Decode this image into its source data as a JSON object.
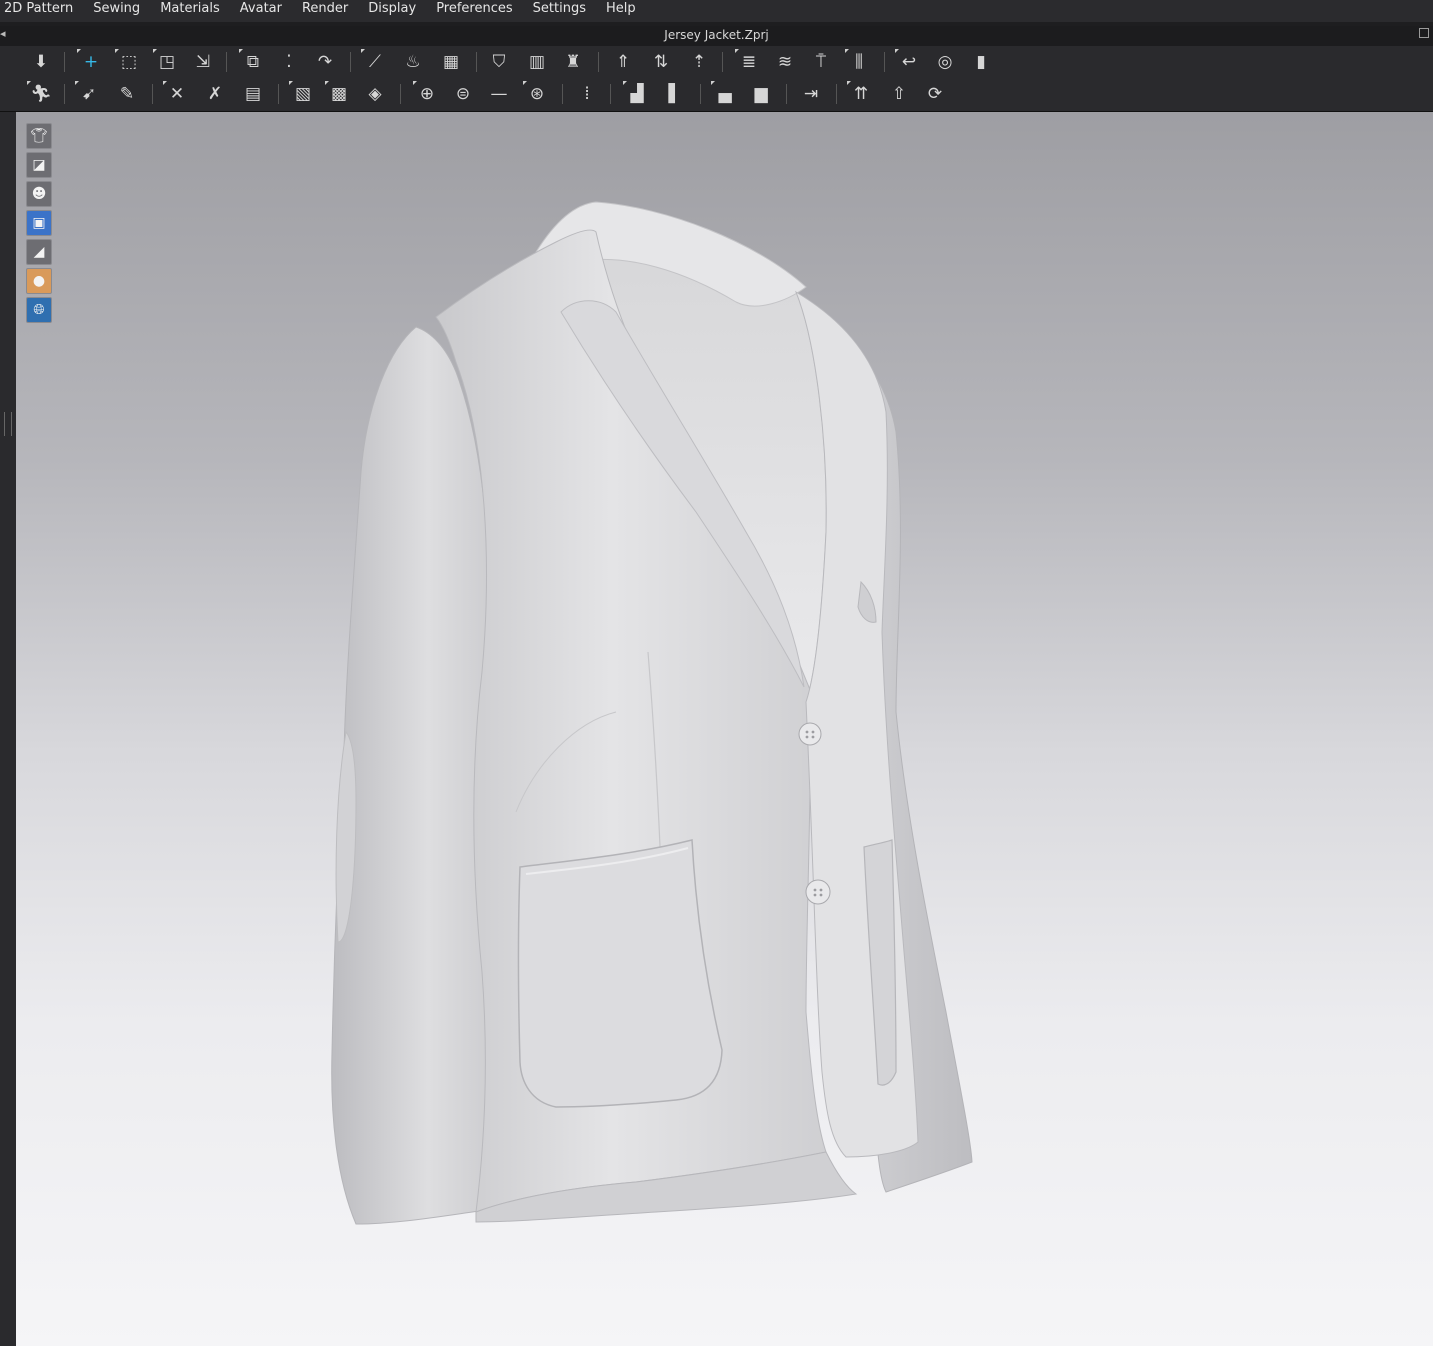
{
  "menubar": {
    "items": [
      "2D Pattern",
      "Sewing",
      "Materials",
      "Avatar",
      "Render",
      "Display",
      "Preferences",
      "Settings",
      "Help"
    ]
  },
  "window": {
    "title": "Jersey Jacket.Zprj"
  },
  "toolbar_row1": {
    "icons": [
      "simulation-icon",
      "select-move-icon",
      "select-mesh-box-icon",
      "select-mesh-brush-icon",
      "fold-arrangement-icon",
      "tack-icon",
      "tack-on-avatar-icon",
      "tack-between-icon",
      "edit-sewing-icon",
      "steam-icon",
      "shrinkage-brush-icon",
      "avatar-arrange-icon",
      "arrangement-point-icon",
      "dressing-icon",
      "fold-icon",
      "fold-down-icon",
      "fold-up-icon",
      "layer-up-icon",
      "layer-down-icon",
      "pin-icon",
      "pin-box-icon",
      "measure-circumference-icon",
      "measure-tape-icon",
      "ruler-icon"
    ]
  },
  "toolbar_row2": {
    "icons": [
      "avatar-pose-icon",
      "avatar-measure-icon",
      "avatar-measure-edit-icon",
      "strap-icon",
      "strap-edit-icon",
      "puckering-icon",
      "texture-edit-icon",
      "graphic-icon",
      "graphic-mesh-icon",
      "button-icon",
      "buttonhole-icon",
      "topstitch-icon",
      "snap-icon",
      "zipper-icon",
      "trim-icon",
      "trim-box-icon",
      "fabric-mesh-icon",
      "fabric-mesh-box-icon",
      "align-icon",
      "piping-icon",
      "piping-edit-icon",
      "rotate-icon"
    ]
  },
  "viewport_tools": [
    {
      "icon": "show-garment-icon",
      "style": "grey"
    },
    {
      "icon": "texture-mode-icon",
      "style": "grey"
    },
    {
      "icon": "show-avatar-icon",
      "style": "grey"
    },
    {
      "icon": "show-3d-pattern-icon",
      "style": "blue"
    },
    {
      "icon": "show-pins-icon",
      "style": "grey"
    },
    {
      "icon": "avatar-skin-icon",
      "style": "skin"
    },
    {
      "icon": "environment-icon",
      "style": "globe"
    }
  ],
  "colors": {
    "accent": "#36b9e8",
    "menubar_bg": "#2b2b2e",
    "toolbar_bg": "#2a2a2d",
    "garment": "#e3e3e5"
  }
}
